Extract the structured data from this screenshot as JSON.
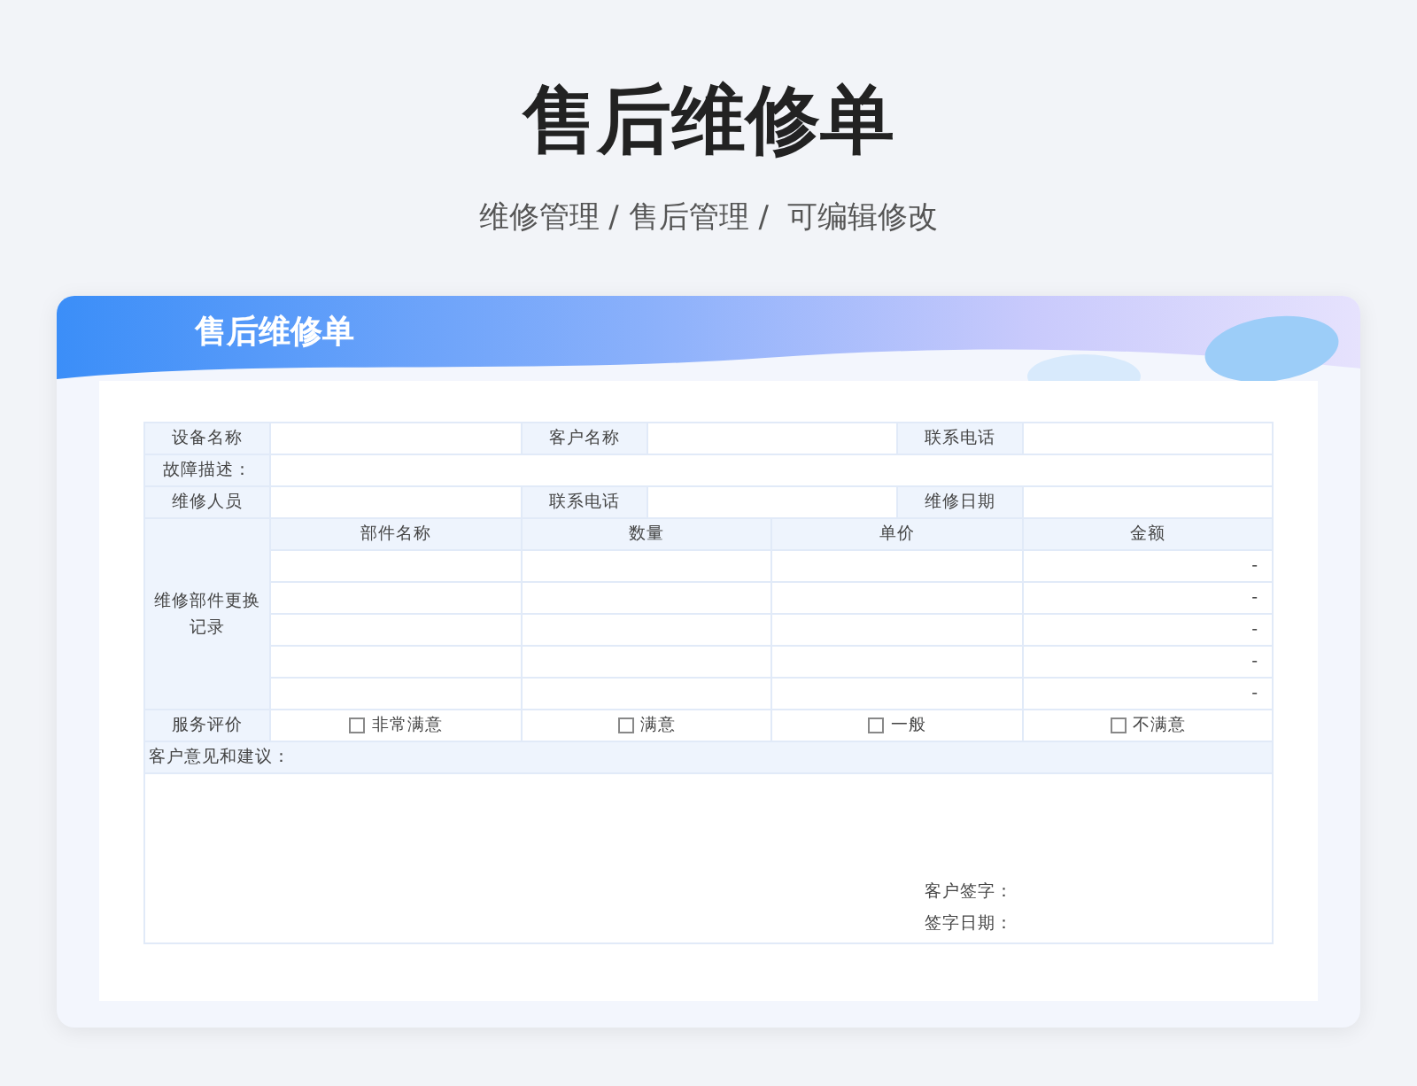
{
  "page_title": "售后维修单",
  "breadcrumb": "维修管理 / 售后管理 /  可编辑修改",
  "card": {
    "title": "售后维修单"
  },
  "info_rows": [
    {
      "kind": "triple",
      "fields": [
        {
          "label": "设备名称"
        },
        {
          "label": "客户名称"
        },
        {
          "label": "联系电话"
        }
      ]
    },
    {
      "kind": "wide",
      "fields": [
        {
          "label": "故障描述："
        }
      ]
    },
    {
      "kind": "triple",
      "fields": [
        {
          "label": "维修人员"
        },
        {
          "label": "联系电话"
        },
        {
          "label": "维修日期"
        }
      ]
    }
  ],
  "parts": {
    "label": "维修部件更换记录",
    "columns": [
      "部件名称",
      "数量",
      "单价",
      "金额"
    ],
    "rows": [
      {
        "amount": "-"
      },
      {
        "amount": "-"
      },
      {
        "amount": "-"
      },
      {
        "amount": "-"
      },
      {
        "amount": "-"
      }
    ]
  },
  "rating": {
    "label": "服务评价",
    "options": [
      {
        "label": "非常满意",
        "checked": false
      },
      {
        "label": "满意",
        "checked": false
      },
      {
        "label": "一般",
        "checked": false
      },
      {
        "label": "不满意",
        "checked": false
      }
    ]
  },
  "comments": {
    "label": "客户意见和建议：",
    "signature_label": "客户签字：",
    "date_label": "签字日期："
  }
}
